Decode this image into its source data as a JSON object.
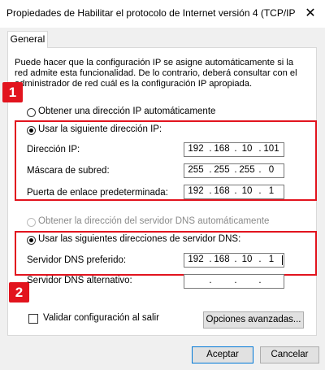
{
  "window": {
    "title": "Propiedades de Habilitar el protocolo de Internet versión 4 (TCP/IP...",
    "close_glyph": "✕"
  },
  "tab": {
    "label": "General"
  },
  "description": "Puede hacer que la configuración IP se asigne automáticamente si la red admite esta funcionalidad. De lo contrario, deberá consultar con el administrador de red cuál es la configuración IP apropiada.",
  "badges": {
    "one": "1",
    "two": "2"
  },
  "ip_section": {
    "auto_label": "Obtener una dirección IP automáticamente",
    "manual_label": "Usar la siguiente dirección IP:",
    "selected": "manual",
    "fields": [
      {
        "label": "Dirección IP:",
        "octets": [
          "192",
          "168",
          "10",
          "101"
        ]
      },
      {
        "label": "Máscara de subred:",
        "octets": [
          "255",
          "255",
          "255",
          "0"
        ]
      },
      {
        "label": "Puerta de enlace predeterminada:",
        "octets": [
          "192",
          "168",
          "10",
          "1"
        ]
      }
    ]
  },
  "dns_section": {
    "auto_label": "Obtener la dirección del servidor DNS automáticamente",
    "manual_label": "Usar las siguientes direcciones de servidor DNS:",
    "selected": "manual",
    "fields": [
      {
        "label": "Servidor DNS preferido:",
        "octets": [
          "192",
          "168",
          "10",
          "1"
        ]
      },
      {
        "label": "Servidor DNS alternativo:",
        "octets": [
          "",
          "",
          "",
          ""
        ]
      }
    ]
  },
  "validate": {
    "label": "Validar configuración al salir",
    "checked": false
  },
  "buttons": {
    "advanced": "Opciones avanzadas...",
    "accept": "Aceptar",
    "cancel": "Cancelar"
  },
  "colors": {
    "highlight_red": "#e2141e",
    "dialog_bg": "#f0f0f0",
    "default_button_border": "#0078d7"
  }
}
